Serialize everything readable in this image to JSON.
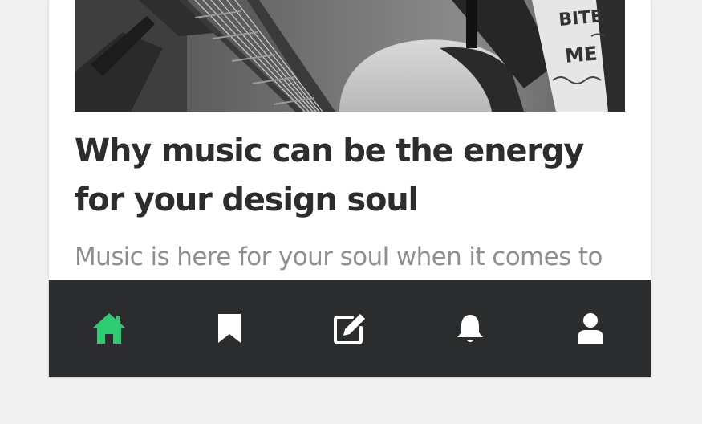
{
  "article": {
    "title": "Why music can be the energy for your design soul",
    "excerpt": "Music is here for your soul when it comes to"
  },
  "bottom_nav": {
    "active_color": "#2ecc71",
    "icon_color": "#ffffff",
    "background": "#2b2c2e",
    "items": [
      {
        "icon": "home-icon",
        "active": true
      },
      {
        "icon": "bookmark-icon",
        "active": false
      },
      {
        "icon": "edit-icon",
        "active": false
      },
      {
        "icon": "bell-icon",
        "active": false
      },
      {
        "icon": "user-icon",
        "active": false
      }
    ]
  }
}
